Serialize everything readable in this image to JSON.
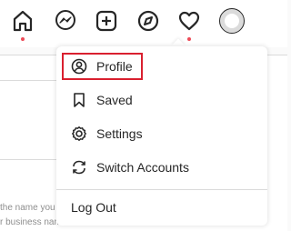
{
  "nav": {
    "icons": [
      "home-icon",
      "messenger-icon",
      "new-post-icon",
      "explore-icon",
      "activity-heart-icon",
      "avatar"
    ]
  },
  "background": {
    "line1": "the name you",
    "line2": "r business name"
  },
  "menu": {
    "items": [
      {
        "label": "Profile",
        "icon": "profile-icon"
      },
      {
        "label": "Saved",
        "icon": "bookmark-icon"
      },
      {
        "label": "Settings",
        "icon": "gear-icon"
      },
      {
        "label": "Switch Accounts",
        "icon": "switch-icon"
      },
      {
        "label": "Log Out"
      }
    ]
  },
  "colors": {
    "notification_dot": "#ed4956",
    "highlight": "#d9202f"
  }
}
